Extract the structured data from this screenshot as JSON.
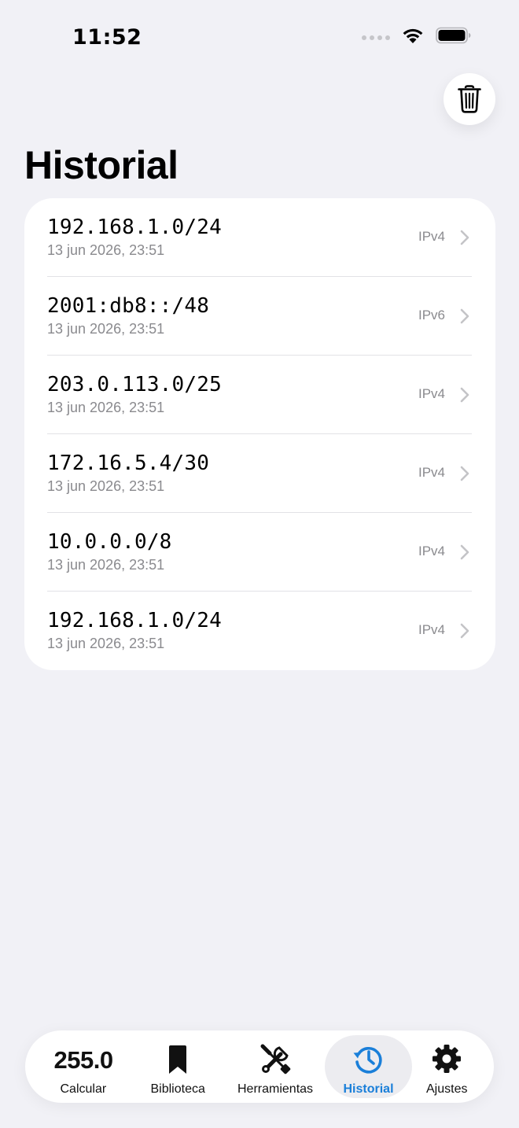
{
  "status_bar": {
    "time": "11:52"
  },
  "header": {
    "title": "Historial",
    "trash_icon": "trash-icon"
  },
  "history": [
    {
      "address": "192.168.1.0/24",
      "date": "13 jun 2026, 23:51",
      "type": "IPv4"
    },
    {
      "address": "2001:db8::/48",
      "date": "13 jun 2026, 23:51",
      "type": "IPv6"
    },
    {
      "address": "203.0.113.0/25",
      "date": "13 jun 2026, 23:51",
      "type": "IPv4"
    },
    {
      "address": "172.16.5.4/30",
      "date": "13 jun 2026, 23:51",
      "type": "IPv4"
    },
    {
      "address": "10.0.0.0/8",
      "date": "13 jun 2026, 23:51",
      "type": "IPv4"
    },
    {
      "address": "192.168.1.0/24",
      "date": "13 jun 2026, 23:51",
      "type": "IPv4"
    }
  ],
  "tab_bar": {
    "tabs": [
      {
        "label": "Calcular",
        "icon_text": "255.0",
        "icon": "number-icon"
      },
      {
        "label": "Biblioteca",
        "icon": "bookmark-icon"
      },
      {
        "label": "Herramientas",
        "icon": "tools-icon"
      },
      {
        "label": "Historial",
        "icon": "history-clock-icon",
        "active": true
      },
      {
        "label": "Ajustes",
        "icon": "gear-icon"
      }
    ]
  },
  "colors": {
    "background": "#f1f1f6",
    "card": "#ffffff",
    "secondary_text": "#8a8a8e",
    "accent": "#1a7fd9",
    "active_tab_bg": "#ececf0"
  }
}
